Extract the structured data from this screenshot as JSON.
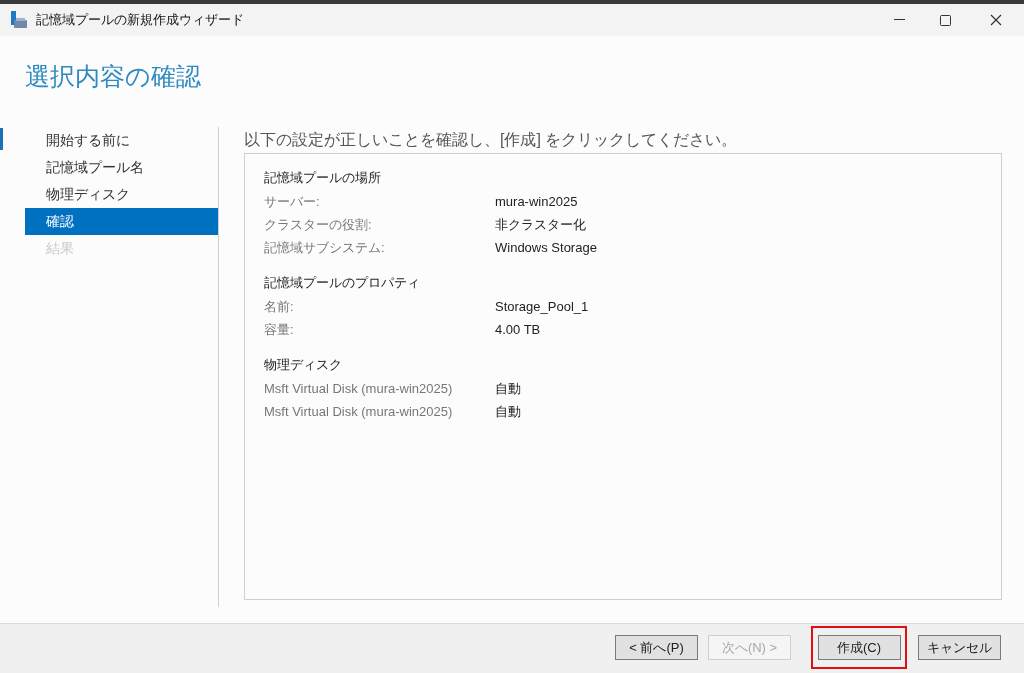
{
  "window": {
    "title": "記憶域プールの新規作成ウィザード"
  },
  "heading": "選択内容の確認",
  "sidebar": {
    "items": [
      {
        "label": "開始する前に",
        "selected": false,
        "disabled": false
      },
      {
        "label": "記憶域プール名",
        "selected": false,
        "disabled": false
      },
      {
        "label": "物理ディスク",
        "selected": false,
        "disabled": false
      },
      {
        "label": "確認",
        "selected": true,
        "disabled": false
      },
      {
        "label": "結果",
        "selected": false,
        "disabled": true
      }
    ]
  },
  "instruction": "以下の設定が正しいことを確認し、[作成] をクリックしてください。",
  "sections": [
    {
      "title": "記憶域プールの場所",
      "rows": [
        {
          "label": "サーバー:",
          "value": "mura-win2025"
        },
        {
          "label": "クラスターの役割:",
          "value": "非クラスター化"
        },
        {
          "label": "記憶域サブシステム:",
          "value": "Windows Storage"
        }
      ]
    },
    {
      "title": "記憶域プールのプロパティ",
      "rows": [
        {
          "label": "名前:",
          "value": "Storage_Pool_1"
        },
        {
          "label": "容量:",
          "value": "4.00 TB"
        }
      ]
    },
    {
      "title": "物理ディスク",
      "rows": [
        {
          "label": "Msft Virtual Disk (mura-win2025)",
          "value": "自動"
        },
        {
          "label": "Msft Virtual Disk (mura-win2025)",
          "value": "自動"
        }
      ]
    }
  ],
  "buttons": [
    {
      "label": "< 前へ(P)",
      "disabled": false,
      "highlighted": false
    },
    {
      "label": "次へ(N) >",
      "disabled": true,
      "highlighted": false
    },
    {
      "label": "作成(C)",
      "disabled": false,
      "highlighted": true
    },
    {
      "label": "キャンセル",
      "disabled": false,
      "highlighted": false
    }
  ]
}
